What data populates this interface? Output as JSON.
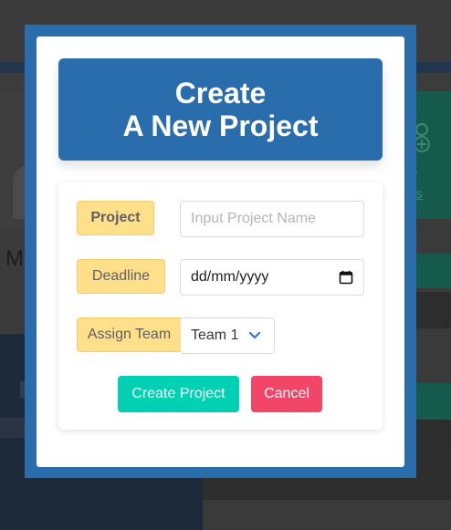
{
  "background": {
    "heading_fragment": "M",
    "manage_text_line1": "ge",
    "manage_text_line2": "ms"
  },
  "modal": {
    "title_line1": "Create",
    "title_line2": "A New Project",
    "project_label": "Project",
    "project_placeholder": "Input Project Name",
    "project_value": "",
    "deadline_label": "Deadline",
    "deadline_value": "dd/mm/yyyy",
    "team_label": "Assign Team",
    "team_selected": "Team 1",
    "create_button": "Create Project",
    "cancel_button": "Cancel"
  },
  "icons": {
    "calendar": "calendar-icon",
    "dropdown": "chevron-down-icon",
    "background_add": "plus-icon"
  },
  "colors": {
    "primary_blue": "#2a6dad",
    "label_yellow": "#ffe08a",
    "create_green": "#00d1b2",
    "cancel_red": "#f14668"
  }
}
